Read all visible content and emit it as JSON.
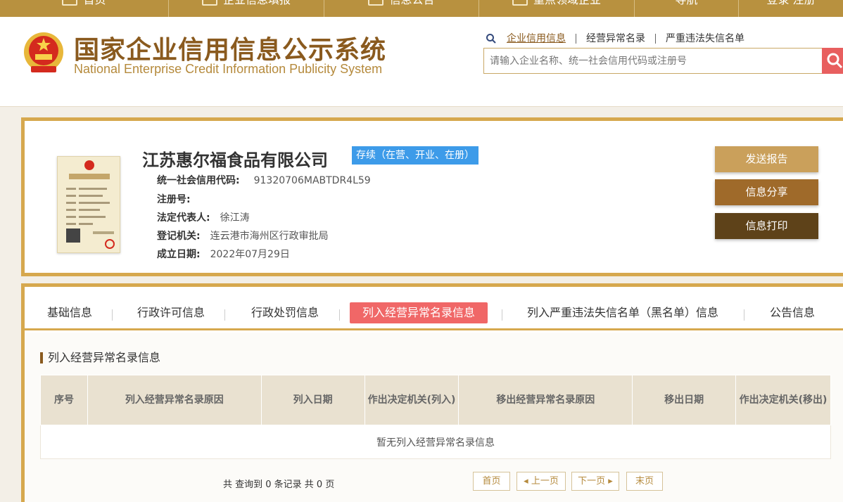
{
  "topnav": {
    "items": [
      "首页",
      "企业信息填报",
      "信息公告",
      "重点领域企业",
      "导航"
    ],
    "login": "登录 注册"
  },
  "header": {
    "title_cn": "国家企业信用信息公示系统",
    "title_en": "National Enterprise Credit Information Publicity System",
    "search_links": [
      "企业信用信息",
      "经营异常名录",
      "严重违法失信名单"
    ],
    "search_placeholder": "请输入企业名称、统一社会信用代码或注册号"
  },
  "company": {
    "name": "江苏惠尔福食品有限公司",
    "status": "存续（在营、开业、在册）",
    "fields": [
      {
        "label": "统一社会信用代码:",
        "value": "91320706MABTDR4L59"
      },
      {
        "label": "注册号:",
        "value": ""
      },
      {
        "label": "法定代表人:",
        "value": "徐江涛"
      },
      {
        "label": "登记机关:",
        "value": "连云港市海州区行政审批局"
      },
      {
        "label": "成立日期:",
        "value": "2022年07月29日"
      }
    ],
    "buttons": {
      "send": "发送报告",
      "share": "信息分享",
      "print": "信息打印"
    }
  },
  "tabs": [
    "基础信息",
    "行政许可信息",
    "行政处罚信息",
    "列入经营异常名录信息",
    "列入严重违法失信名单（黑名单）信息",
    "公告信息"
  ],
  "active_tab": 3,
  "section": {
    "title": "列入经营异常名录信息",
    "columns": [
      "序号",
      "列入经营异常名录原因",
      "列入日期",
      "作出决定机关(列入)",
      "移出经营异常名录原因",
      "移出日期",
      "作出决定机关(移出)"
    ],
    "empty_text": "暂无列入经营异常名录信息",
    "pager_info": "共 查询到 0 条记录 共 0 页",
    "pager": {
      "first": "首页",
      "prev": "上一页",
      "next": "下一页",
      "last": "末页"
    }
  },
  "colors": {
    "gold": "#d6a84e",
    "brown": "#8a5a1e",
    "status_blue": "#3d9be9",
    "active_tab": "#f06767",
    "search_btn": "#e85f5f"
  }
}
